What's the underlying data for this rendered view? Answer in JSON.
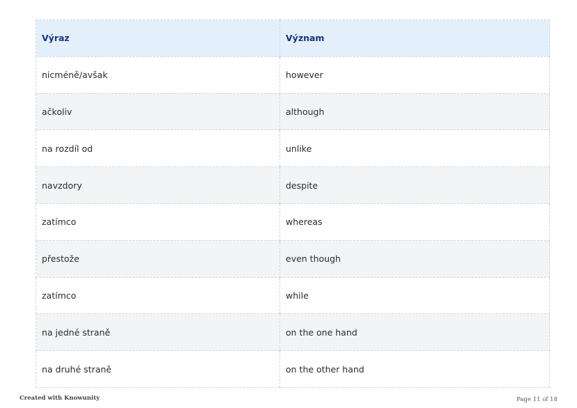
{
  "table": {
    "headers": [
      "Výraz",
      "Význam"
    ],
    "rows": [
      [
        "nicméně/avšak",
        "however"
      ],
      [
        "ačkoliv",
        "although"
      ],
      [
        "na rozdíl od",
        "unlike"
      ],
      [
        "navzdory",
        "despite"
      ],
      [
        "zatímco",
        "whereas"
      ],
      [
        "přestože",
        "even though"
      ],
      [
        "zatímco",
        "while"
      ],
      [
        "na jedné straně",
        "on the one hand"
      ],
      [
        "na druhé straně",
        "on the other hand"
      ]
    ]
  },
  "footer": {
    "credit": "Created with Knowunity",
    "page": "Page 11 of 18"
  },
  "colors": {
    "header_bg": "#e3f0fc",
    "header_text": "#16357a",
    "stripe_bg": "#f3f4f6",
    "border": "#c9d6e3"
  }
}
